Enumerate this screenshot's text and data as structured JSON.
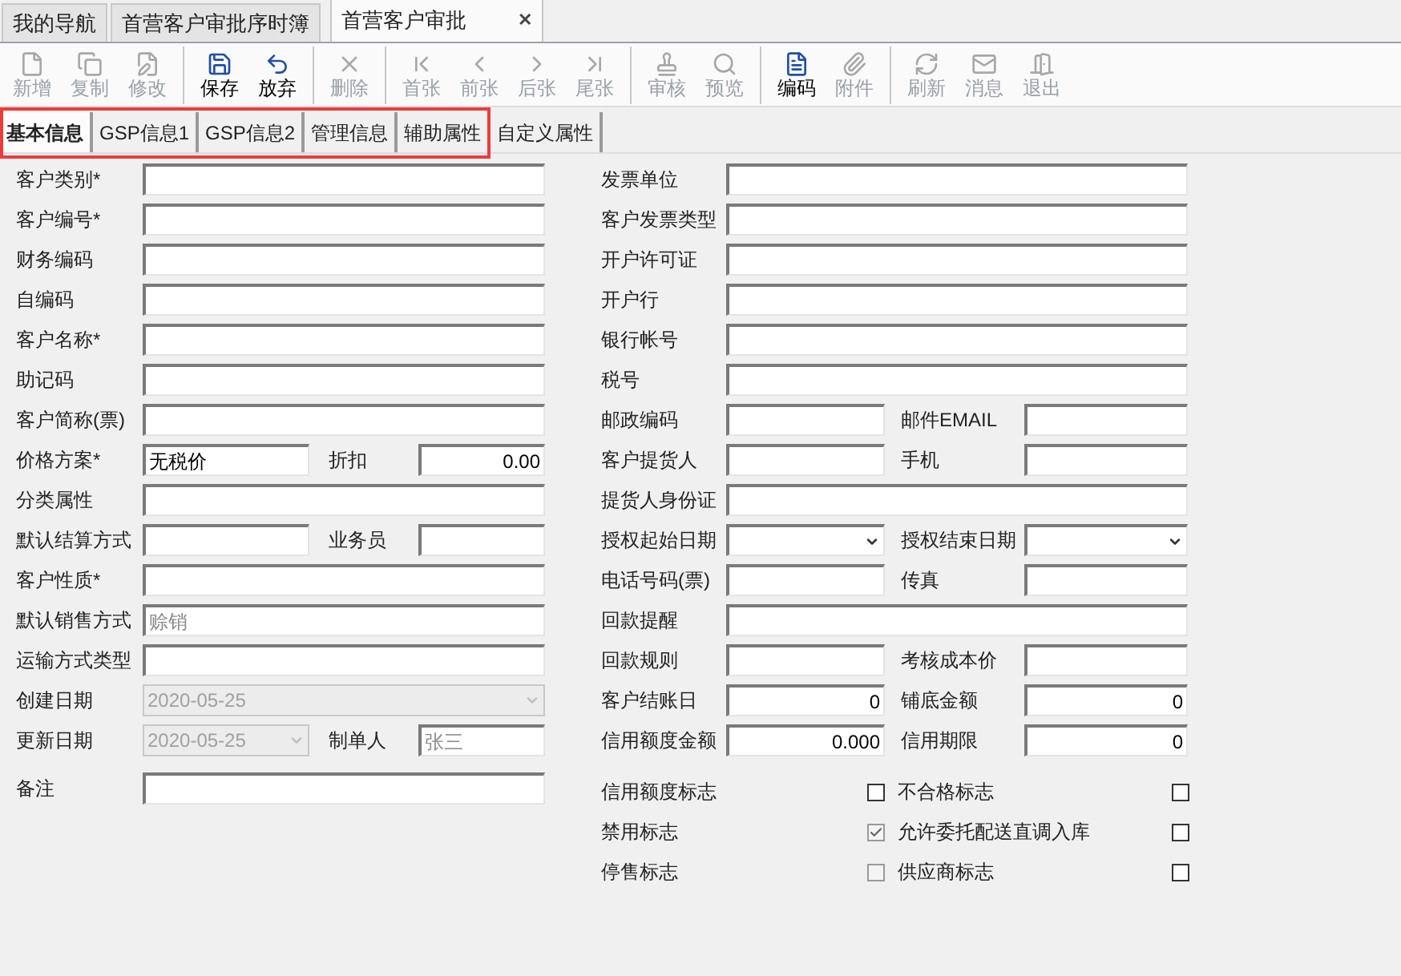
{
  "doc_tabs": [
    {
      "label": "我的导航",
      "selected": false,
      "closable": false
    },
    {
      "label": "首营客户审批序时簿",
      "selected": false,
      "closable": false
    },
    {
      "label": "首营客户审批",
      "selected": true,
      "closable": true,
      "close": "✕"
    }
  ],
  "toolbar": [
    [
      {
        "label": "新增",
        "disabled": true
      },
      {
        "label": "复制",
        "disabled": true
      },
      {
        "label": "修改",
        "disabled": true
      }
    ],
    [
      {
        "label": "保存",
        "disabled": false
      },
      {
        "label": "放弃",
        "disabled": false
      }
    ],
    [
      {
        "label": "删除",
        "disabled": true
      }
    ],
    [
      {
        "label": "首张",
        "disabled": true
      },
      {
        "label": "前张",
        "disabled": true
      },
      {
        "label": "后张",
        "disabled": true
      },
      {
        "label": "尾张",
        "disabled": true
      }
    ],
    [
      {
        "label": "审核",
        "disabled": true
      },
      {
        "label": "预览",
        "disabled": true
      }
    ],
    [
      {
        "label": "编码",
        "disabled": false
      },
      {
        "label": "附件",
        "disabled": true
      }
    ],
    [
      {
        "label": "刷新",
        "disabled": true
      },
      {
        "label": "消息",
        "disabled": true
      },
      {
        "label": "退出",
        "disabled": true
      }
    ]
  ],
  "sub_tabs": [
    {
      "label": "基本信息",
      "selected": true
    },
    {
      "label": "GSP信息1",
      "selected": false
    },
    {
      "label": "GSP信息2",
      "selected": false
    },
    {
      "label": "管理信息",
      "selected": false
    },
    {
      "label": "辅助属性",
      "selected": false
    },
    {
      "label": "自定义属性",
      "selected": false
    }
  ],
  "left_rows": [
    {
      "label": "客户类别*",
      "field": {
        "kind": "text"
      }
    },
    {
      "label": "客户编号*",
      "field": {
        "kind": "text"
      }
    },
    {
      "label": "财务编码",
      "field": {
        "kind": "text"
      }
    },
    {
      "label": "自编码",
      "field": {
        "kind": "text"
      }
    },
    {
      "label": "客户名称*",
      "field": {
        "kind": "text"
      }
    },
    {
      "label": "助记码",
      "field": {
        "kind": "text"
      }
    },
    {
      "label": "客户简称(票)",
      "field": {
        "kind": "text"
      }
    },
    {
      "label": "价格方案*",
      "field": {
        "kind": "text",
        "value": "无税价"
      },
      "label2": "折扣",
      "field2": {
        "kind": "number",
        "value": "0.00"
      }
    },
    {
      "label": "分类属性",
      "field": {
        "kind": "text"
      }
    },
    {
      "label": "默认结算方式",
      "field": {
        "kind": "text"
      },
      "label2": "业务员",
      "field2": {
        "kind": "text"
      }
    },
    {
      "label": "客户性质*",
      "field": {
        "kind": "text"
      }
    },
    {
      "label": "默认销售方式",
      "field": {
        "kind": "readonly",
        "value": "赊销"
      }
    },
    {
      "label": "运输方式类型",
      "field": {
        "kind": "text"
      }
    },
    {
      "label": "创建日期",
      "field": {
        "kind": "date",
        "value": "2020-05-25"
      }
    },
    {
      "label": "更新日期",
      "field": {
        "kind": "date",
        "value": "2020-05-25"
      },
      "label2": "制单人",
      "field2": {
        "kind": "readonly",
        "value": "张三"
      }
    },
    {
      "label": "备注",
      "field": {
        "kind": "text"
      }
    }
  ],
  "right_rows": [
    {
      "label": "发票单位",
      "field": {
        "kind": "text"
      }
    },
    {
      "label": "客户发票类型",
      "field": {
        "kind": "text"
      }
    },
    {
      "label": "开户许可证",
      "field": {
        "kind": "text"
      }
    },
    {
      "label": "开户行",
      "field": {
        "kind": "text"
      }
    },
    {
      "label": "银行帐号",
      "field": {
        "kind": "text"
      }
    },
    {
      "label": "税号",
      "field": {
        "kind": "text"
      }
    },
    {
      "label": "邮政编码",
      "field": {
        "kind": "text"
      },
      "label2": "邮件EMAIL",
      "field2": {
        "kind": "text"
      }
    },
    {
      "label": "客户提货人",
      "field": {
        "kind": "text"
      },
      "label2": "手机",
      "field2": {
        "kind": "text"
      }
    },
    {
      "label": "提货人身份证",
      "field": {
        "kind": "text"
      }
    },
    {
      "label": "授权起始日期",
      "field": {
        "kind": "dropdown"
      },
      "label2": "授权结束日期",
      "field2": {
        "kind": "dropdown"
      }
    },
    {
      "label": "电话号码(票)",
      "field": {
        "kind": "text"
      },
      "label2": "传真",
      "field2": {
        "kind": "text"
      }
    },
    {
      "label": "回款提醒",
      "field": {
        "kind": "text"
      }
    },
    {
      "label": "回款规则",
      "field": {
        "kind": "text"
      },
      "label2": "考核成本价",
      "field2": {
        "kind": "text"
      }
    },
    {
      "label": "客户结账日",
      "field": {
        "kind": "number",
        "value": "0"
      },
      "label2": "铺底金额",
      "field2": {
        "kind": "number",
        "value": "0"
      }
    },
    {
      "label": "信用额度金额",
      "field": {
        "kind": "number",
        "value": "0.000"
      },
      "label2": "信用期限",
      "field2": {
        "kind": "number",
        "value": "0"
      }
    }
  ],
  "flags": [
    [
      {
        "label": "信用额度标志",
        "checked": false,
        "disabled": false
      },
      {
        "label": "不合格标志",
        "checked": false,
        "disabled": false
      }
    ],
    [
      {
        "label": "禁用标志",
        "checked": true,
        "disabled": true
      },
      {
        "label": "允许委托配送直调入库",
        "checked": false,
        "disabled": false
      }
    ],
    [
      {
        "label": "停售标志",
        "checked": false,
        "disabled": true
      },
      {
        "label": "供应商标志",
        "checked": false,
        "disabled": false
      }
    ]
  ]
}
